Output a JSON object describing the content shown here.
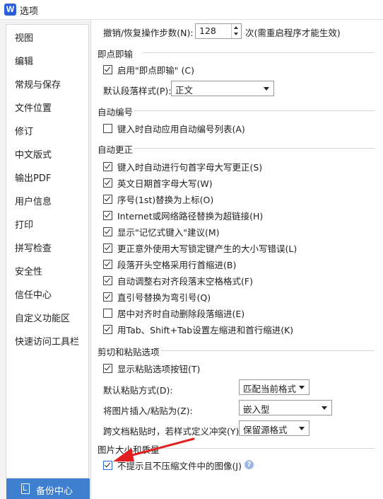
{
  "window": {
    "title": "选项",
    "logo_letter": "W"
  },
  "sidebar": {
    "items": [
      "视图",
      "编辑",
      "常规与保存",
      "文件位置",
      "修订",
      "中文版式",
      "输出PDF",
      "用户信息",
      "打印",
      "拼写检查",
      "安全性",
      "信任中心",
      "自定义功能区",
      "快速访问工具栏"
    ],
    "active": "编辑",
    "backup_label": "备份中心"
  },
  "undo": {
    "label": "撤销/恢复操作步数(N):",
    "value": "128",
    "note": "次(需重启程序才能生效)"
  },
  "instant_input": {
    "section": "即点即输",
    "enable_label": "启用\"即点即输\" (C)",
    "enable_checked": true,
    "style_label": "默认段落样式(P):",
    "style_value": "正文"
  },
  "auto_number": {
    "section": "自动编号",
    "item_label": "键入时自动应用自动编号列表(A)",
    "item_checked": false
  },
  "auto_correct": {
    "section": "自动更正",
    "items": [
      {
        "label": "键入时自动进行句首字母大写更正(S)",
        "checked": true
      },
      {
        "label": "英文日期首字母大写(W)",
        "checked": true
      },
      {
        "label": "序号(1st)替换为上标(O)",
        "checked": true
      },
      {
        "label": "Internet或网络路径替换为超链接(H)",
        "checked": true
      },
      {
        "label": "显示\"记忆式键入\"建议(M)",
        "checked": true
      },
      {
        "label": "更正意外使用大写锁定键产生的大小写错误(L)",
        "checked": true
      },
      {
        "label": "段落开头空格采用行首缩进(B)",
        "checked": true
      },
      {
        "label": "自动调整右对齐段落末空格格式(F)",
        "checked": true
      },
      {
        "label": "直引号替换为弯引号(Q)",
        "checked": true
      },
      {
        "label": "居中对齐时自动删除段落缩进(E)",
        "checked": false
      },
      {
        "label": "用Tab、Shift+Tab设置左缩进和首行缩进(K)",
        "checked": true
      }
    ]
  },
  "paste": {
    "section": "剪切和粘贴选项",
    "show_btn_label": "显示粘贴选项按钮(T)",
    "show_btn_checked": true,
    "default_label": "默认粘贴方式(D):",
    "default_value": "匹配当前格式",
    "image_label": "将图片插入/粘贴为(Z):",
    "image_value": "嵌入型",
    "conflict_label": "跨文档粘贴时，若样式定义冲突(Y):",
    "conflict_value": "保留源格式"
  },
  "image_quality": {
    "section": "图片大小和质量",
    "item_label": "不提示且不压缩文件中的图像(J)",
    "item_checked": true,
    "help_glyph": "?"
  },
  "colors": {
    "accent": "#3f7fcf",
    "annotation_arrow": "#e02020"
  }
}
